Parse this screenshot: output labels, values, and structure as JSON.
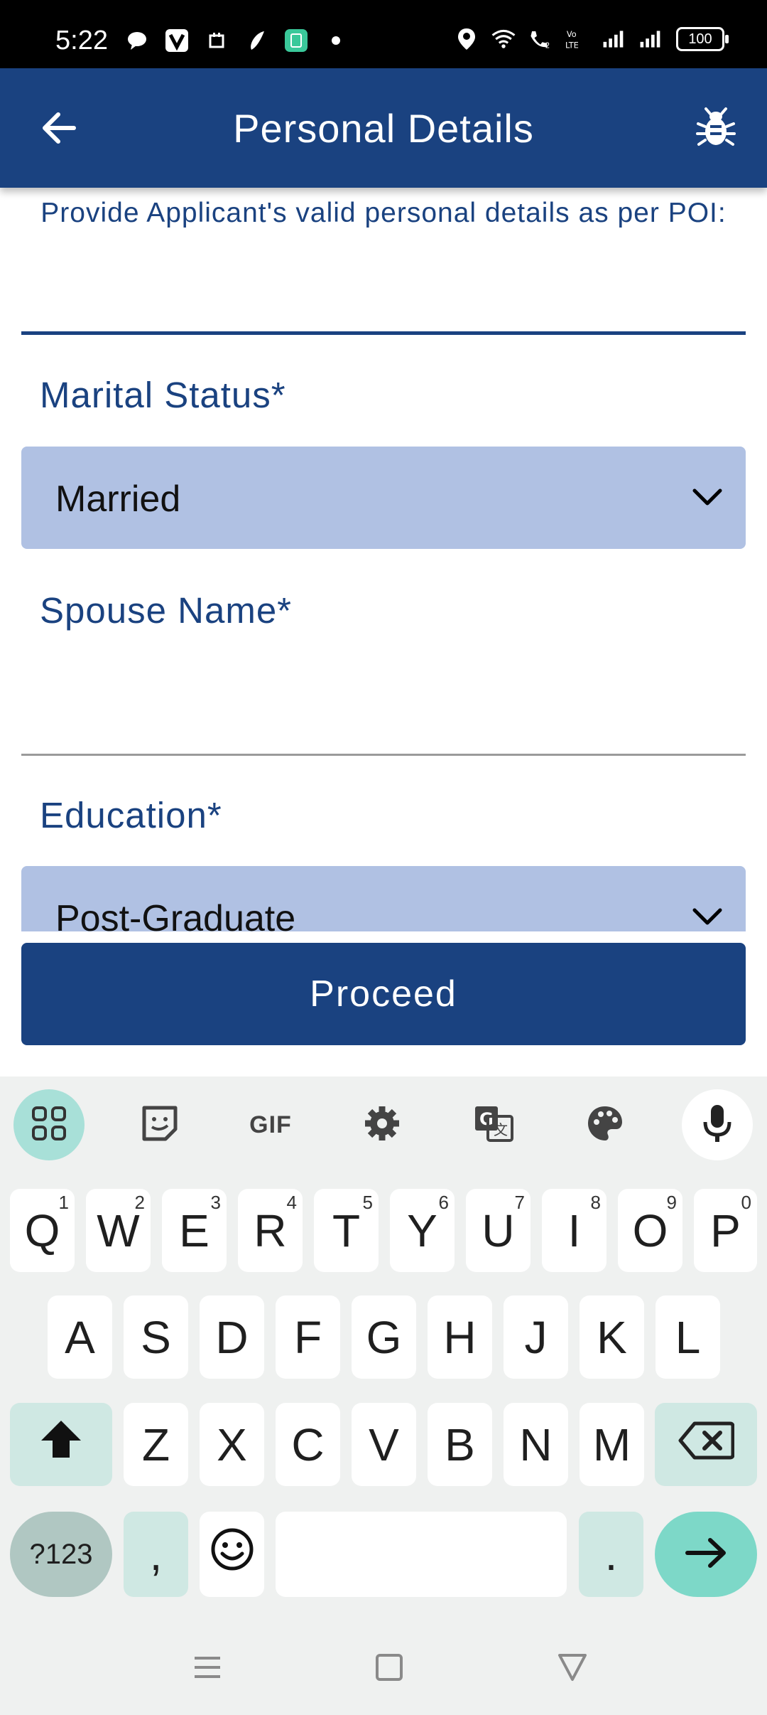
{
  "status_bar": {
    "time": "5:22",
    "battery": "100",
    "icons_left": [
      "chat-bubble-icon",
      "v-app-icon",
      "calendar-icon",
      "app-icon",
      "calculator-icon",
      "dot-icon"
    ],
    "icons_right": [
      "location-icon",
      "wifi-icon",
      "wifi-call-icon",
      "volte-icon",
      "signal-1-icon",
      "signal-2-icon"
    ]
  },
  "app_bar": {
    "title": "Personal Details",
    "back_icon": "arrow-left-icon",
    "bug_icon": "bug-icon",
    "color": "#1a4280"
  },
  "form": {
    "subtitle": "Provide Applicant's valid personal details as per POI:",
    "marital_status": {
      "label": "Marital Status*",
      "value": "Married"
    },
    "spouse_name": {
      "label": "Spouse Name*",
      "value": ""
    },
    "education": {
      "label": "Education*",
      "value": "Post-Graduate"
    },
    "dropdown_color": "#b0c1e3"
  },
  "proceed_button": {
    "label": "Proceed"
  },
  "keyboard": {
    "toolbar": [
      "apps-icon",
      "sticker-icon",
      "GIF",
      "settings-icon",
      "translate-icon",
      "palette-icon",
      "mic-icon"
    ],
    "gif_label": "GIF",
    "row1": [
      {
        "k": "Q",
        "h": "1"
      },
      {
        "k": "W",
        "h": "2"
      },
      {
        "k": "E",
        "h": "3"
      },
      {
        "k": "R",
        "h": "4"
      },
      {
        "k": "T",
        "h": "5"
      },
      {
        "k": "Y",
        "h": "6"
      },
      {
        "k": "U",
        "h": "7"
      },
      {
        "k": "I",
        "h": "8"
      },
      {
        "k": "O",
        "h": "9"
      },
      {
        "k": "P",
        "h": "0"
      }
    ],
    "row2": [
      "A",
      "S",
      "D",
      "F",
      "G",
      "H",
      "J",
      "K",
      "L"
    ],
    "row3": [
      "Z",
      "X",
      "C",
      "V",
      "B",
      "N",
      "M"
    ],
    "symbols_label": "?123",
    "comma_label": ",",
    "period_label": ".",
    "accent_color": "#7dd8c8"
  },
  "nav_bar": [
    "menu-icon",
    "home-square-icon",
    "back-triangle-icon"
  ]
}
